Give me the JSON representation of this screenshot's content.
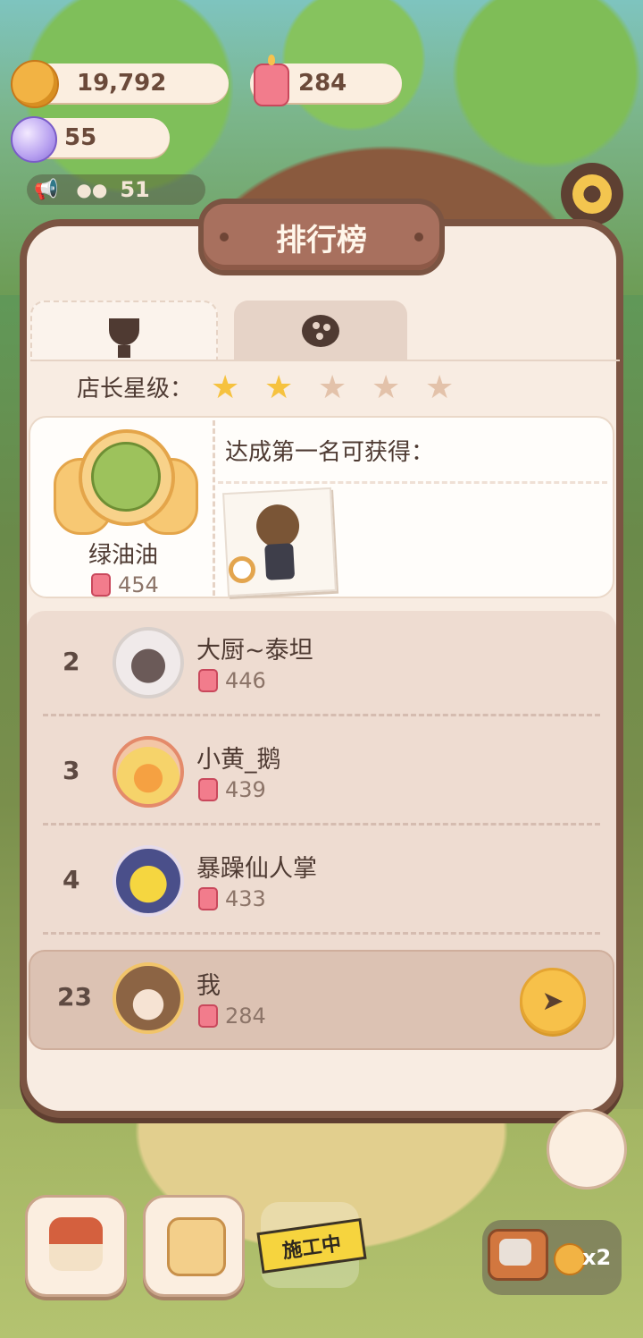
{
  "currency": {
    "coins": "19,792",
    "candles": "284",
    "gems": "55",
    "visitors": "51"
  },
  "leaderboard": {
    "title": "排行榜",
    "tabs": [
      {
        "icon": "trophy-icon",
        "active": true
      },
      {
        "icon": "planet-icon",
        "active": false
      }
    ],
    "star_label": "店长星级：",
    "star_rating": {
      "filled": 2,
      "total": 5
    },
    "first_place": {
      "name": "绿油油",
      "score": "454",
      "reward_label": "达成第一名可获得："
    },
    "rows": [
      {
        "rank": "2",
        "name": "大厨~泰坦",
        "score": "446"
      },
      {
        "rank": "3",
        "name": "小黄_鹅",
        "score": "439"
      },
      {
        "rank": "4",
        "name": "暴躁仙人掌",
        "score": "433"
      }
    ],
    "me": {
      "rank": "23",
      "name": "我",
      "score": "284"
    }
  },
  "bottom_bar": {
    "construction_label": "施工中",
    "reward_multiplier": "x2"
  },
  "colors": {
    "panel_border": "#7b5442",
    "panel_bg": "#f8ece2",
    "star_on": "#f6c23f",
    "star_off": "#e3c2aa",
    "accent_button": "#f7c14a"
  }
}
